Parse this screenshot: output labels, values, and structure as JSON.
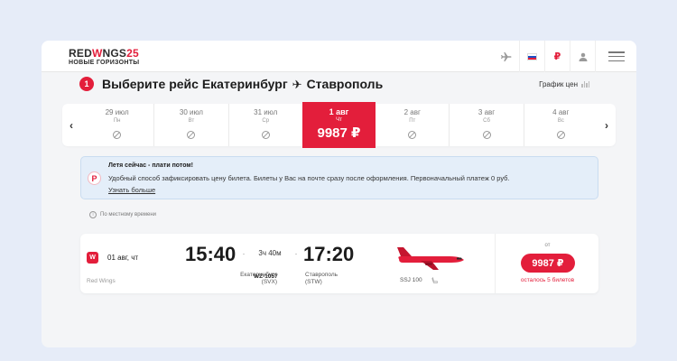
{
  "header": {
    "logo_main_left": "RED",
    "logo_main_mid": "W",
    "logo_main_right": "NGS",
    "logo_main_tail": "25",
    "logo_sub": "НОВЫЕ ГОРИЗОНТЫ",
    "currency_symbol": "₽",
    "icons": [
      "plane-icon",
      "flag-icon",
      "ruble-icon",
      "user-icon",
      "menu-icon"
    ]
  },
  "step": {
    "number": "1",
    "title_prefix": "Выберите рейс",
    "origin": "Екатеринбург",
    "plane_glyph": "✈",
    "destination": "Ставрополь",
    "price_graph_label": "График цен"
  },
  "dates": {
    "prev_arrow": "‹",
    "next_arrow": "›",
    "items": [
      {
        "date": "29 июл",
        "weekday": "Пн"
      },
      {
        "date": "30 июл",
        "weekday": "Вт"
      },
      {
        "date": "31 июл",
        "weekday": "Ср"
      },
      {
        "date": "1 авг",
        "weekday": "Чт",
        "price": "9987 ₽"
      },
      {
        "date": "2 авг",
        "weekday": "Пт"
      },
      {
        "date": "3 авг",
        "weekday": "Сб"
      },
      {
        "date": "4 авг",
        "weekday": "Вс"
      }
    ]
  },
  "info": {
    "logo_glyph": "P",
    "title": "Летя сейчас - плати потом!",
    "text": "Удобный способ зафиксировать цену билета. Билеты у Вас на почте сразу после оформления. Первоначальный платеж 0 руб.",
    "link": "Узнать больше"
  },
  "local_time_note": "По местному времени",
  "flight": {
    "airline_logo_glyph": "W",
    "date": "01 авг, чт",
    "airline": "Red Wings",
    "departure_time": "15:40",
    "arrival_time": "17:20",
    "duration": "3ч 40м",
    "departure_city": "Екатеринбург",
    "departure_code": "(SVX)",
    "flight_number": "WZ-1057",
    "arrival_city": "Ставрополь",
    "arrival_code": "(STW)",
    "aircraft": "SSJ 100",
    "price_from_label": "от",
    "price": "9987 ₽",
    "tickets_left": "осталось 5 билетов"
  },
  "colors": {
    "accent": "#e31e3b",
    "page_bg": "#e6ecf8",
    "info_bg": "#e4eef9"
  }
}
